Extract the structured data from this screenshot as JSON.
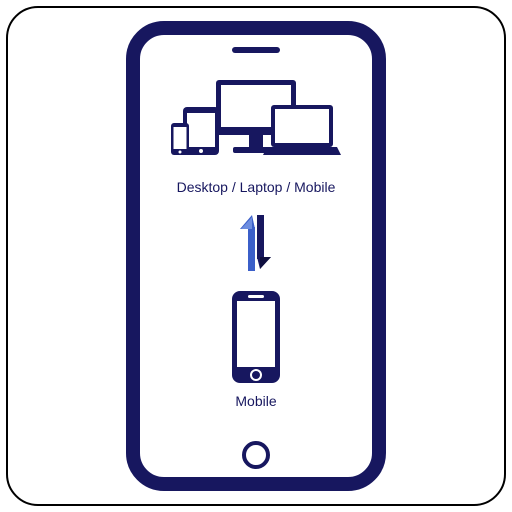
{
  "colors": {
    "navy": "#17175f",
    "blue": "#3b5fc9",
    "darkblue": "#1a2a6c"
  },
  "devices_label": "Desktop / Laptop / Mobile",
  "mobile_label": "Mobile"
}
